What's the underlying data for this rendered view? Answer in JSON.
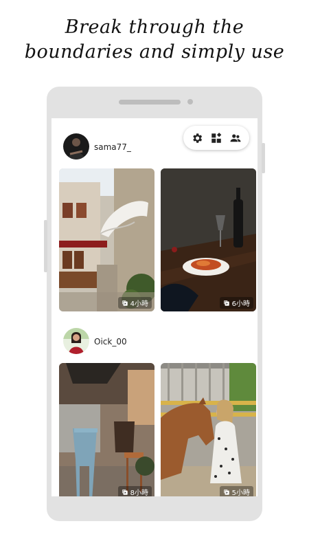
{
  "headline": {
    "line1": "Break through the",
    "line2": "boundaries and simply use"
  },
  "toolbar": {
    "icons": [
      "settings-gear-icon",
      "widgets-icon",
      "people-icon"
    ]
  },
  "posts": [
    {
      "user": "sama77_",
      "avatar_icon": "user-avatar",
      "photos": [
        {
          "subject": "old-town-alley-with-awning",
          "time": "4小時",
          "badge_icon": "video-clip-icon"
        },
        {
          "subject": "pasta-and-wine-still-life",
          "time": "6小時",
          "badge_icon": "video-clip-icon"
        }
      ]
    },
    {
      "user": "Oick_00",
      "avatar_icon": "user-avatar",
      "photos": [
        {
          "subject": "cafe-chairs-outdoor",
          "time": "8小時",
          "badge_icon": "video-clip-icon"
        },
        {
          "subject": "girl-hugging-horse",
          "time": "5小時",
          "badge_icon": "video-clip-icon"
        }
      ]
    }
  ],
  "colors": {
    "phone_frame": "#e2e2e2",
    "screen_bg": "#ffffff",
    "badge_bg": "rgba(0,0,0,0.35)"
  }
}
